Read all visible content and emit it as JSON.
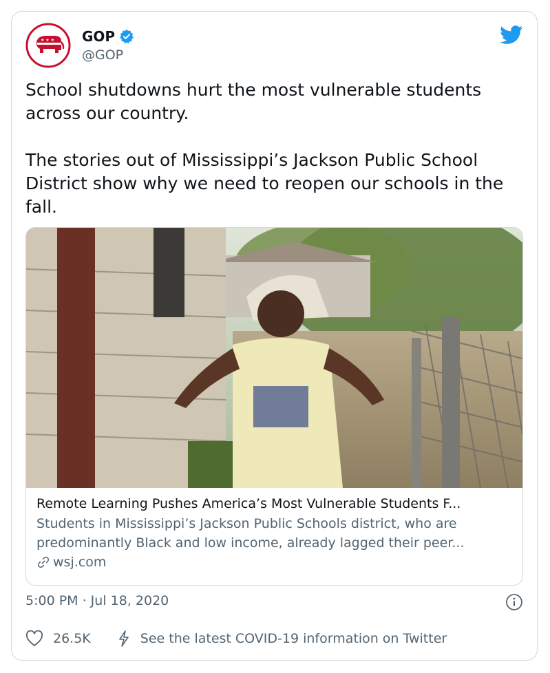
{
  "colors": {
    "brand_red": "#c8102e",
    "verified_blue": "#1d9bf0",
    "twitter_blue": "#1d9bf0",
    "text_secondary": "#536471"
  },
  "author": {
    "name": "GOP",
    "handle": "@GOP",
    "avatar_icon": "republican-elephant-logo",
    "verified_icon": "verified-badge-icon"
  },
  "tweet": {
    "text": "School shutdowns hurt the most vulnerable students across our country.\n\nThe stories out of Mississippi’s Jackson Public School District show why we need to reopen our schools in the fall."
  },
  "link_card": {
    "image_description": "photo",
    "title": "Remote Learning Pushes America’s Most Vulnerable Students F...",
    "description": "Students in Mississippi’s Jackson Public Schools district, who are predominantly Black and low income, already lagged their peer...",
    "domain": "wsj.com",
    "domain_icon": "link-icon"
  },
  "meta": {
    "timestamp": "5:00 PM · Jul 18, 2020",
    "info_icon": "info-icon"
  },
  "footer": {
    "like_icon": "heart-icon",
    "like_count": "26.5K",
    "covid_icon": "lightning-icon",
    "covid_text": "See the latest COVID-19 information on Twitter"
  }
}
